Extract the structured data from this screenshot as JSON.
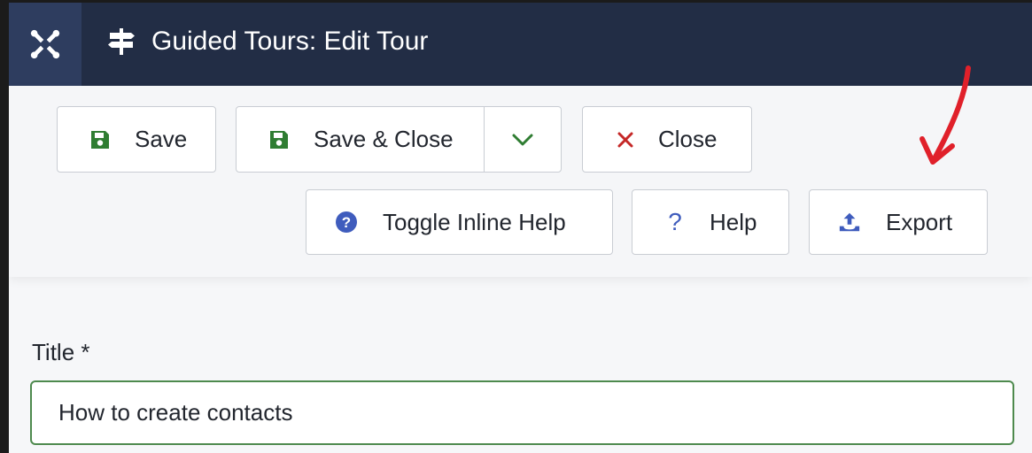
{
  "header": {
    "title": "Guided Tours: Edit Tour",
    "logo_icon": "joomla-logo-icon",
    "title_icon": "signpost-icon",
    "background_color": "#222d45",
    "logo_background_color": "#2e3d5f"
  },
  "toolbar": {
    "save_label": "Save",
    "save_close_label": "Save & Close",
    "close_label": "Close",
    "toggle_inline_help_label": "Toggle Inline Help",
    "help_label": "Help",
    "export_label": "Export",
    "save_icon_color": "#2f7d32",
    "close_icon_color": "#c52827",
    "help_icon_color": "#3f5cbd",
    "icons": {
      "save": "save-icon",
      "save_close": "save-icon",
      "dropdown": "chevron-down-icon",
      "close": "close-icon",
      "toggle_inline_help": "question-circle-icon",
      "help": "question-icon",
      "export": "upload-icon"
    }
  },
  "annotation": {
    "arrow_color": "#e0202a",
    "points_to": "export-button"
  },
  "form": {
    "title_label": "Title *",
    "title_value": "How to create contacts",
    "input_border_color": "#4e8a4e"
  }
}
